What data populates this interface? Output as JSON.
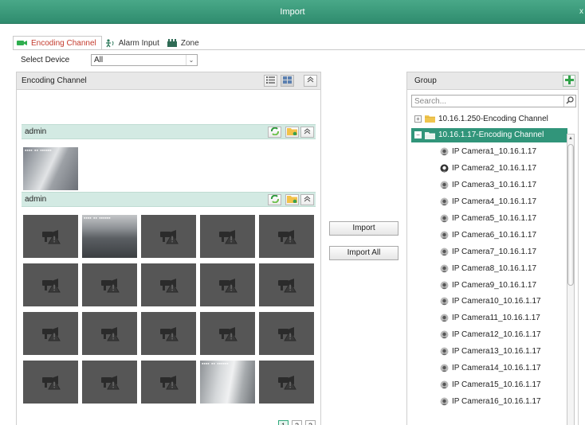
{
  "window": {
    "title": "Import",
    "close_glyph": "x"
  },
  "tabs": [
    {
      "label": "Encoding Channel",
      "icon": "camera-icon",
      "active": true
    },
    {
      "label": "Alarm Input",
      "icon": "alarm-input-icon",
      "active": false
    },
    {
      "label": "Zone",
      "icon": "zone-icon",
      "active": false
    }
  ],
  "select_device": {
    "label": "Select Device",
    "value": "All",
    "arrow": "⌄"
  },
  "encoding_panel": {
    "title": "Encoding Channel",
    "groups": [
      {
        "name": "admin",
        "thumbnails": [
          "live"
        ]
      },
      {
        "name": "admin",
        "thumbnails": [
          "no-video",
          "live",
          "no-video",
          "no-video",
          "no-video",
          "no-video",
          "no-video",
          "no-video",
          "no-video",
          "no-video",
          "no-video",
          "no-video",
          "no-video",
          "no-video",
          "no-video",
          "no-video",
          "no-video",
          "no-video",
          "live",
          "no-video"
        ]
      }
    ],
    "pages": [
      "1",
      "2",
      "3"
    ],
    "current_page": "1"
  },
  "actions": {
    "import_label": "Import",
    "import_all_label": "Import All"
  },
  "group_panel": {
    "title": "Group",
    "search_placeholder": "Search...",
    "nodes": [
      {
        "label": "10.16.1.250-Encoding Channel",
        "type": "folder",
        "expander": "+",
        "selected": false
      },
      {
        "label": "10.16.1.17-Encoding Channel",
        "type": "folder",
        "expander": "−",
        "selected": true
      },
      {
        "label": "IP Camera1_10.16.1.17",
        "type": "camera",
        "status": "offline"
      },
      {
        "label": "IP Camera2_10.16.1.17",
        "type": "camera",
        "status": "online"
      },
      {
        "label": "IP Camera3_10.16.1.17",
        "type": "camera",
        "status": "offline"
      },
      {
        "label": "IP Camera4_10.16.1.17",
        "type": "camera",
        "status": "offline"
      },
      {
        "label": "IP Camera5_10.16.1.17",
        "type": "camera",
        "status": "offline"
      },
      {
        "label": "IP Camera6_10.16.1.17",
        "type": "camera",
        "status": "offline"
      },
      {
        "label": "IP Camera7_10.16.1.17",
        "type": "camera",
        "status": "offline"
      },
      {
        "label": "IP Camera8_10.16.1.17",
        "type": "camera",
        "status": "offline"
      },
      {
        "label": "IP Camera9_10.16.1.17",
        "type": "camera",
        "status": "offline"
      },
      {
        "label": "IP Camera10_10.16.1.17",
        "type": "camera",
        "status": "offline"
      },
      {
        "label": "IP Camera11_10.16.1.17",
        "type": "camera",
        "status": "offline"
      },
      {
        "label": "IP Camera12_10.16.1.17",
        "type": "camera",
        "status": "offline"
      },
      {
        "label": "IP Camera13_10.16.1.17",
        "type": "camera",
        "status": "offline"
      },
      {
        "label": "IP Camera14_10.16.1.17",
        "type": "camera",
        "status": "offline"
      },
      {
        "label": "IP Camera15_10.16.1.17",
        "type": "camera",
        "status": "offline"
      },
      {
        "label": "IP Camera16_10.16.1.17",
        "type": "camera",
        "status": "offline"
      }
    ]
  },
  "colors": {
    "titlebar": "#3a9a7b",
    "accent": "#31957a",
    "active_tab_text": "#c43b2d"
  }
}
